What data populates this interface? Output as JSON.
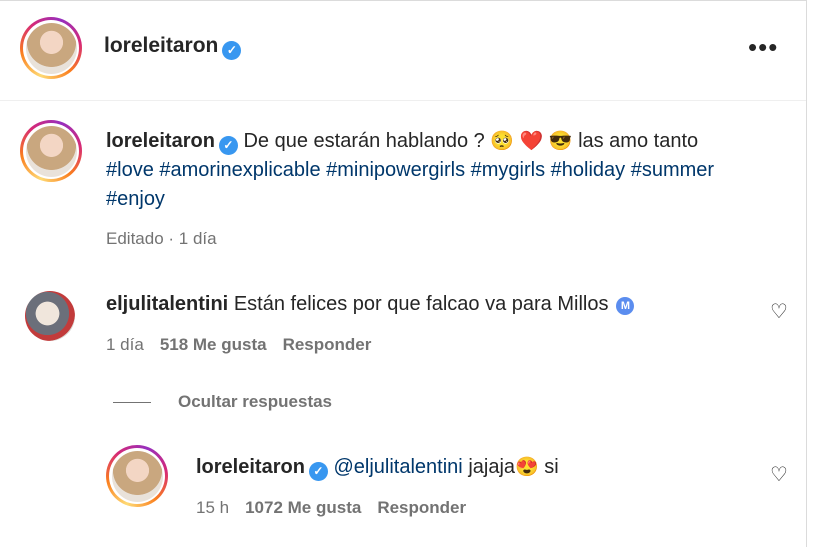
{
  "header": {
    "username": "loreleitaron",
    "more_label": "•••"
  },
  "caption": {
    "username": "loreleitaron",
    "text_before": "De que estarán hablando ?",
    "emojis": [
      "🥺",
      "❤️",
      "😎"
    ],
    "text_after": "las amo tanto",
    "hashtags": [
      "#love",
      "#amorinexplicable",
      "#minipowergirls",
      "#mygirls",
      "#holiday",
      "#summer",
      "#enjoy"
    ],
    "edited": "Editado",
    "time": "1 día"
  },
  "comment": {
    "username": "eljulitalentini",
    "text": "Están felices por que falcao va para Millos",
    "badge": "M",
    "time": "1 día",
    "likes": "518 Me gusta",
    "reply_label": "Responder"
  },
  "replies_toggle": "Ocultar respuestas",
  "reply": {
    "username": "loreleitaron",
    "mention": "@eljulitalentini",
    "text": "jajaja",
    "emoji": "😍",
    "text_after": "si",
    "time": "15 h",
    "likes": "1072 Me gusta",
    "reply_label": "Responder"
  },
  "icons": {
    "verified": "verified-badge-icon",
    "heart": "heart-outline-icon",
    "more": "more-options-icon"
  },
  "colors": {
    "verified": "#3897f0",
    "hashtag": "#00376b",
    "meta": "#737373"
  }
}
